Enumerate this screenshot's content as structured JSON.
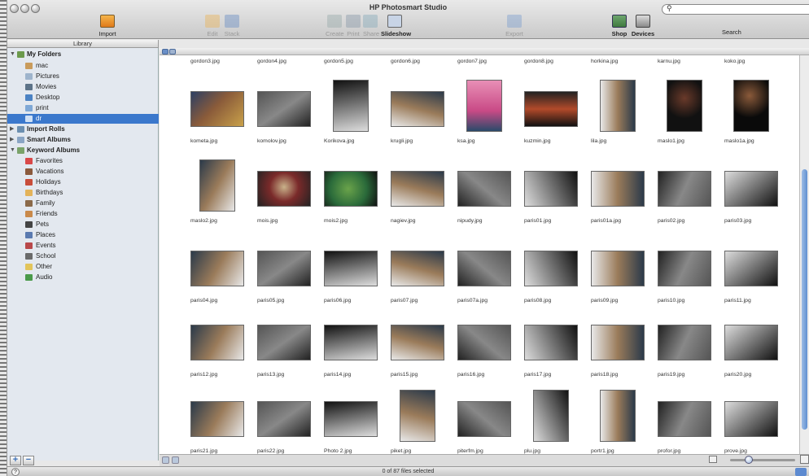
{
  "window": {
    "title": "HP Photosmart Studio"
  },
  "toolbar": {
    "import": "Import",
    "edit": "Edit",
    "stack": "Stack",
    "create": "Create",
    "print": "Print",
    "share": "Share",
    "slideshow": "Slideshow",
    "export": "Export",
    "shop": "Shop",
    "devices": "Devices",
    "search_label": "Search",
    "search_value": ""
  },
  "sidebar": {
    "header": "Library",
    "my_folders": "My Folders",
    "folders": [
      "mac",
      "Pictures",
      "Movies",
      "Desktop",
      "print",
      "dr"
    ],
    "import_rolls": "Import Rolls",
    "smart_albums": "Smart Albums",
    "keyword_albums": "Keyword Albums",
    "keywords": [
      "Favorites",
      "Vacations",
      "Holidays",
      "Birthdays",
      "Family",
      "Friends",
      "Pets",
      "Places",
      "Events",
      "School",
      "Other",
      "Audio"
    ]
  },
  "top_row_names": [
    "gordon3.jpg",
    "gordon4.jpg",
    "gordon5.jpg",
    "gordon6.jpg",
    "gordon7.jpg",
    "gordon8.jpg",
    "horkina.jpg",
    "karnu.jpg",
    "koko.jpg"
  ],
  "rows": [
    [
      "kometa.jpg",
      "komolov.jpg",
      "Korikova.jpg",
      "krugli.jpg",
      "ksa.jpg",
      "kuzmin.jpg",
      "lila.jpg",
      "maslo1.jpg",
      "maslo1a.jpg"
    ],
    [
      "maslo2.jpg",
      "mois.jpg",
      "mois2.jpg",
      "nagiev.jpg",
      "nipudy.jpg",
      "paris01.jpg",
      "paris01a.jpg",
      "paris02.jpg",
      "paris03.jpg"
    ],
    [
      "paris04.jpg",
      "paris05.jpg",
      "paris06.jpg",
      "paris07.jpg",
      "paris07a.jpg",
      "paris08.jpg",
      "paris09.jpg",
      "paris10.jpg",
      "paris11.jpg"
    ],
    [
      "paris12.jpg",
      "paris13.jpg",
      "paris14.jpg",
      "paris15.jpg",
      "paris16.jpg",
      "paris17.jpg",
      "paris18.jpg",
      "paris19.jpg",
      "paris20.jpg"
    ],
    [
      "paris21.jpg",
      "paris22.jpg",
      "Photo 2.jpg",
      "piket.jpg",
      "piterfm.jpg",
      "plu.jpg",
      "portr1.jpg",
      "profor.jpg",
      "prove.jpg"
    ]
  ],
  "status": {
    "text": "0 of 87 files selected",
    "help": "?"
  },
  "buttons": {
    "add": "+",
    "remove": "−"
  }
}
